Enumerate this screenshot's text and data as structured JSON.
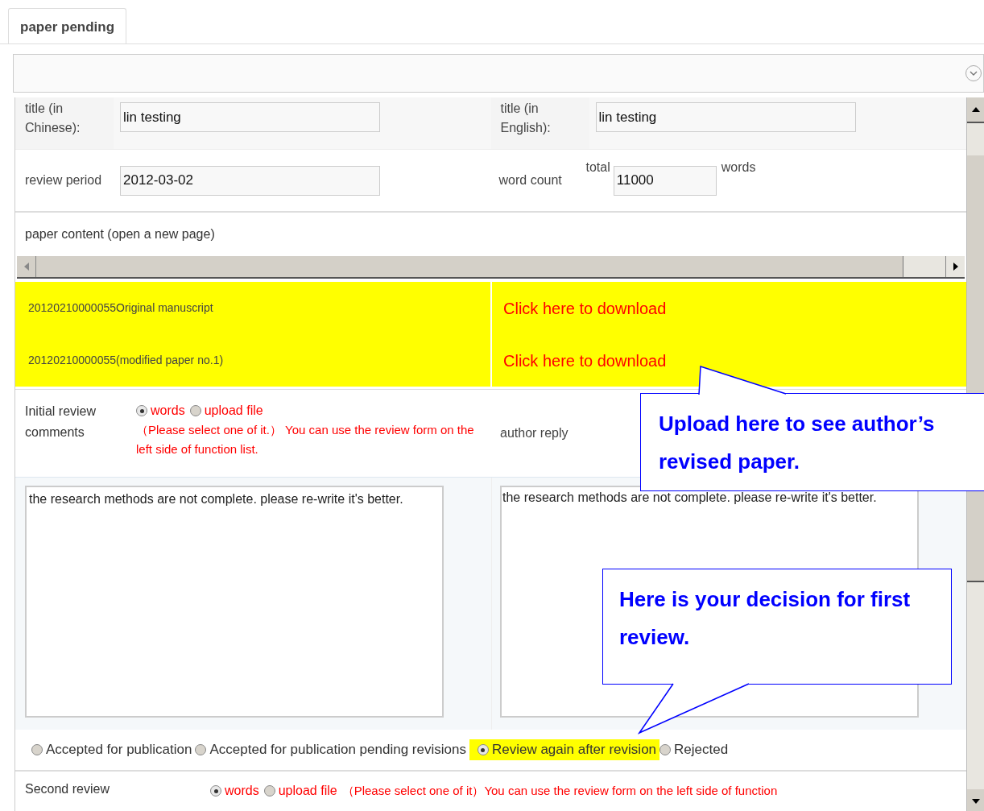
{
  "tab": {
    "label": "paper pending",
    "selected": true
  },
  "titles": [
    {
      "label": "title (in Chinese):",
      "value": "lin testing"
    },
    {
      "label": "title (in English):",
      "value": "lin testing"
    }
  ],
  "review_period": {
    "label": "review period",
    "value": "2012-03-02"
  },
  "word_count": {
    "label": "word count",
    "prefix": "total",
    "value": "11000",
    "suffix": "words"
  },
  "paper_content": {
    "label": "paper content (open a new page)"
  },
  "files": [
    {
      "name": "20120210000055Original manuscript",
      "link": "Click here to download"
    },
    {
      "name": "20120210000055(modified paper no.1)",
      "link": "Click here to download"
    }
  ],
  "initial_review": {
    "label": "Initial review comments",
    "options": [
      {
        "label": "words",
        "selected": true
      },
      {
        "label": "upload file",
        "selected": false
      }
    ],
    "note": "（Please select one of it.） You can use the review form on the left side of function list.",
    "reply_label": "author reply",
    "comment": "the research methods are not complete. please re-write it's better.",
    "reply": "the research methods are not complete. please re-write it's better."
  },
  "decision": [
    {
      "label": "Accepted for publication",
      "selected": false
    },
    {
      "label": "Accepted for publication pending revisions",
      "selected": false
    },
    {
      "label": "Review again after revision",
      "selected": true
    },
    {
      "label": "Rejected",
      "selected": false
    }
  ],
  "second_review": {
    "label": "Second review",
    "options": [
      {
        "label": "words",
        "selected": true
      },
      {
        "label": "upload file",
        "selected": false
      }
    ],
    "note": "（Please select one of it）You can use the review form on the left side of function"
  },
  "callouts": [
    {
      "text": "Upload here to see author’s revised paper."
    },
    {
      "text": "Here is your decision for first review."
    }
  ]
}
